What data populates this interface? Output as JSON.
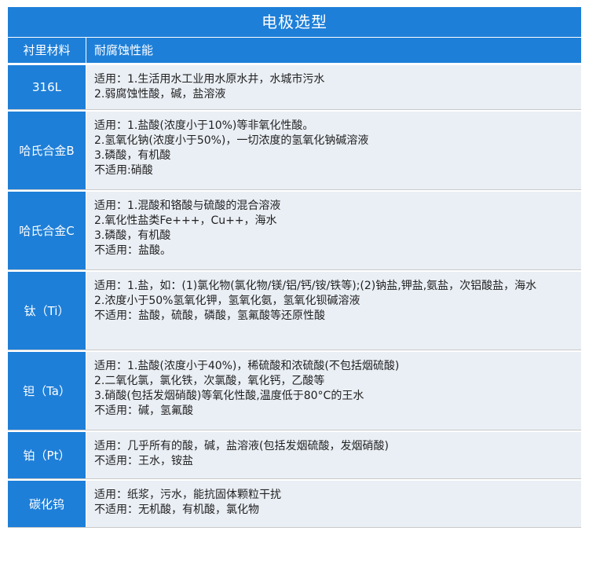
{
  "title": "电极选型",
  "header": {
    "material": "衬里材料",
    "performance": "耐腐蚀性能"
  },
  "rows": [
    {
      "material": "316L",
      "lines": [
        "适用：1.生活用水工业用水原水井，水城市污水",
        "2.弱腐蚀性酸，碱，盐溶液"
      ]
    },
    {
      "material": "哈氏合金B",
      "lines": [
        "适用：1.盐酸(浓度小于10%)等非氧化性酸。",
        "2.氢氧化钠(浓度小于50%)，一切浓度的氢氧化钠碱溶液",
        "3.磷酸，有机酸",
        "不适用:硝酸"
      ]
    },
    {
      "material": "哈氏合金C",
      "lines": [
        "适用：1.混酸和铬酸与硫酸的混合溶液",
        "2.氧化性盐类Fe+++，Cu++，海水",
        "3.磷酸，有机酸",
        "不适用：盐酸。"
      ]
    },
    {
      "material": "钛（Ti）",
      "lines": [
        "适用：1.盐，如：(1)氯化物(氯化物/镁/铝/钙/铵/铁等);(2)钠盐,钾盐,氨盐，次铝酸盐，海水",
        "2.浓度小于50%氢氧化钾，氢氧化氨，氢氧化钡碱溶液",
        "不适用：盐酸，硫酸，磷酸，氢氟酸等还原性酸"
      ]
    },
    {
      "material": "钽（Ta）",
      "lines": [
        "适用：1.盐酸(浓度小于40%)，稀硫酸和浓硫酸(不包括烟硫酸)",
        "2.二氧化氯，氯化铁，次氯酸，氧化钙，乙酸等",
        "3.硝酸(包括发烟硝酸)等氧化性酸,温度低于80°C的王水",
        "不适用：碱，氢氟酸"
      ]
    },
    {
      "material": "铂（Pt）",
      "lines": [
        "适用：几乎所有的酸，碱，盐溶液(包括发烟硫酸，发烟硝酸)",
        "不适用：王水，铵盐"
      ]
    },
    {
      "material": "碳化钨",
      "lines": [
        "适用：纸浆，污水，能抗固体颗粒干扰",
        "不适用：无机酸，有机酸，氯化物"
      ]
    }
  ],
  "colors": {
    "accent": "#1e7fd8",
    "cell_bg": "#eaeff5",
    "border": "#c9c9c9"
  }
}
